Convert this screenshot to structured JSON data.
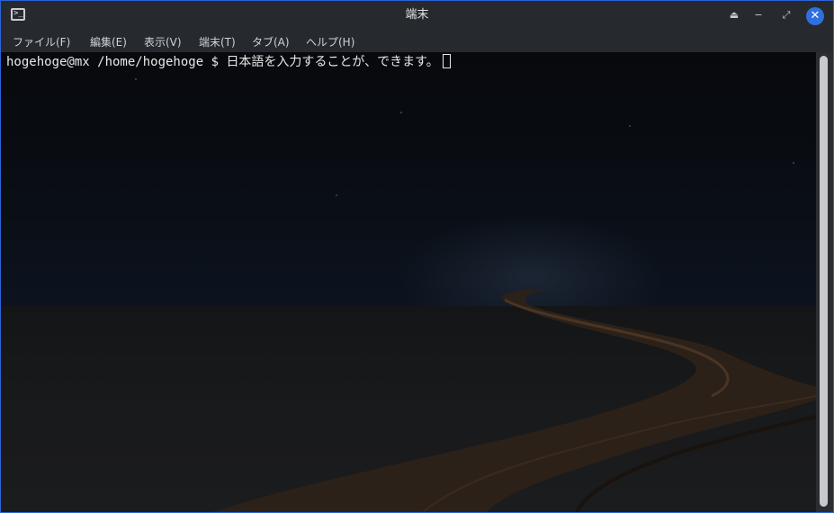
{
  "window": {
    "title": "端末",
    "accent_color": "#2e63d6",
    "controls": {
      "shade_icon": "⏏",
      "minimize_icon": "−",
      "maximize_icon": "⤢",
      "close_icon": "✕"
    }
  },
  "menu": {
    "items": [
      {
        "label": "ファイル(F)"
      },
      {
        "label": "編集(E)"
      },
      {
        "label": "表示(V)"
      },
      {
        "label": "端末(T)"
      },
      {
        "label": "タブ(A)"
      },
      {
        "label": "ヘルプ(H)"
      }
    ]
  },
  "terminal": {
    "prompt": "hogehoge@mx /home/hogehoge $ ",
    "input": "日本語を入力することが、できます。",
    "background": "night road wallpaper"
  },
  "icons": {
    "app": "terminal-icon",
    "shade": "shade-icon",
    "minimize": "minimize-icon",
    "maximize": "maximize-icon",
    "close": "close-icon"
  }
}
